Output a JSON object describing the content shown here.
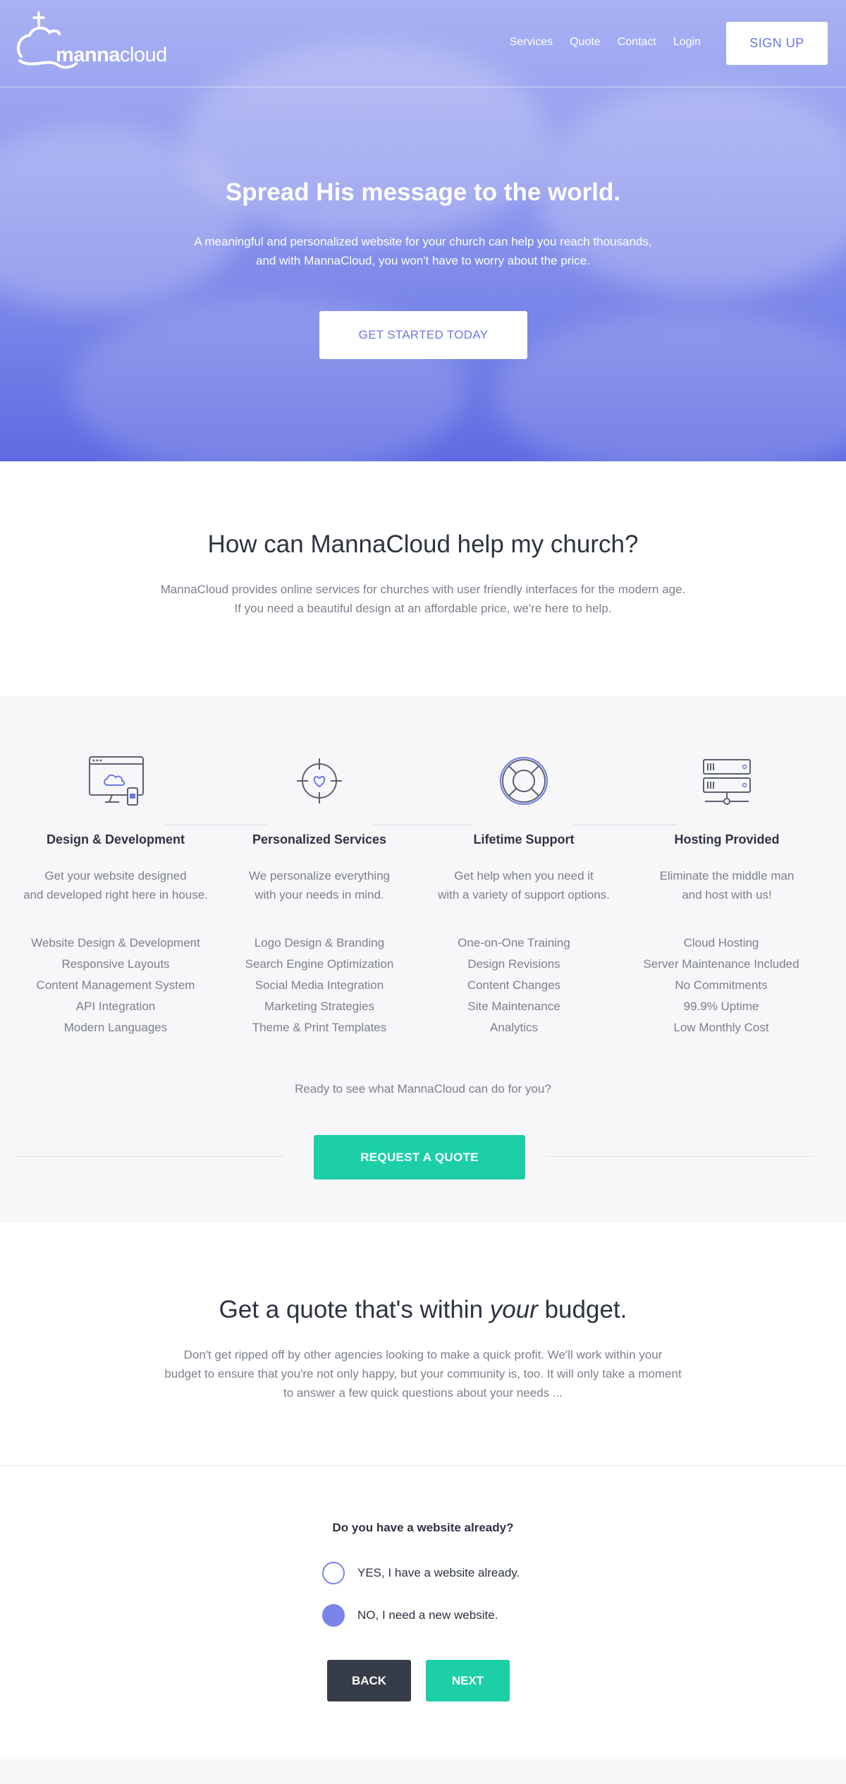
{
  "nav": {
    "logo_bold": "manna",
    "logo_light": "cloud",
    "links": [
      "Services",
      "Quote",
      "Contact",
      "Login"
    ],
    "signup_label": "SIGN UP"
  },
  "hero": {
    "title": "Spread His message to the world.",
    "subtitle_line1": "A meaningful and personalized website for your church can help you reach thousands,",
    "subtitle_line2": "and with MannaCloud, you won't have to worry about the price.",
    "cta_label": "GET STARTED TODAY"
  },
  "intro": {
    "title": "How can MannaCloud help my church?",
    "line1": "MannaCloud provides online services for churches with user friendly interfaces for the modern age.",
    "line2": "If you need a beautiful design at an affordable price, we're here to help."
  },
  "features": [
    {
      "icon": "monitor-cloud-icon",
      "title": "Design & Development",
      "desc1": "Get your website designed",
      "desc2": "and developed right here in house.",
      "items": [
        "Website Design & Development",
        "Responsive Layouts",
        "Content Management System",
        "API Integration",
        "Modern Languages"
      ]
    },
    {
      "icon": "target-heart-icon",
      "title": "Personalized Services",
      "desc1": "We personalize everything",
      "desc2": "with your needs in mind.",
      "items": [
        "Logo Design & Branding",
        "Search Engine Optimization",
        "Social Media Integration",
        "Marketing Strategies",
        "Theme & Print Templates"
      ]
    },
    {
      "icon": "lifebuoy-icon",
      "title": "Lifetime Support",
      "desc1": "Get help when you need it",
      "desc2": "with a variety of support options.",
      "items": [
        "One-on-One Training",
        "Design Revisions",
        "Content Changes",
        "Site Maintenance",
        "Analytics"
      ]
    },
    {
      "icon": "server-icon",
      "title": "Hosting Provided",
      "desc1": "Eliminate the middle man",
      "desc2": "and host with us!",
      "items": [
        "Cloud Hosting",
        "Server Maintenance Included",
        "No Commitments",
        "99.9% Uptime",
        "Low Monthly Cost"
      ]
    }
  ],
  "ready_text": "Ready to see what MannaCloud can do for you?",
  "request_quote_label": "REQUEST A QUOTE",
  "quote": {
    "title_before": "Get a quote that's within ",
    "title_em": "your",
    "title_after": " budget.",
    "line1": "Don't get ripped off by other agencies looking to make a quick profit. We'll work within your",
    "line2": "budget to ensure that you're not only happy, but your community is, too. It will only take a moment",
    "line3": "to answer a few quick questions about your needs ..."
  },
  "form": {
    "question": "Do you have a website already?",
    "options": [
      {
        "label": "YES, I have a website already.",
        "selected": false
      },
      {
        "label": "NO, I need a new website.",
        "selected": true
      }
    ],
    "back_label": "BACK",
    "next_label": "NEXT"
  },
  "colors": {
    "accent": "#7a85ea",
    "teal": "#1ccfa7",
    "dark": "#373c49"
  }
}
